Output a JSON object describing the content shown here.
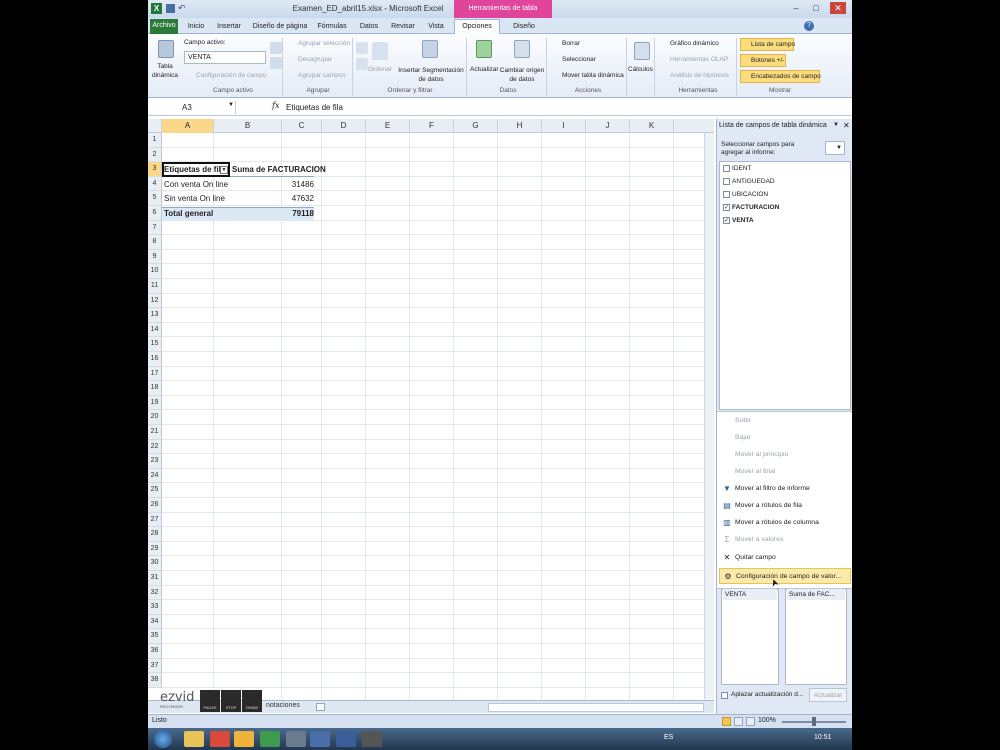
{
  "window": {
    "title": "Examen_ED_abril15.xlsx - Microsoft Excel",
    "context_tab_title": "Herramientas de tabla dinámica"
  },
  "tabs": [
    "Archivo",
    "Inicio",
    "Insertar",
    "Diseño de página",
    "Fórmulas",
    "Datos",
    "Revisar",
    "Vista",
    "Opciones",
    "Diseño"
  ],
  "ribbon": {
    "tabla_dinamica": "Tabla dinámica",
    "campo_activo_label": "Campo activo:",
    "campo_activo_value": "VENTA",
    "configuracion_campo": "Configuración de campo",
    "group_campo_activo": "Campo activo",
    "agrupar_seleccion": "Agrupar selección",
    "desagrupar": "Desagrupar",
    "agrupar_campos": "Agrupar campos",
    "group_agrupar": "Agrupar",
    "ordenar": "Ordenar",
    "insertar_segmentacion": "Insertar Segmentación de datos",
    "group_ordenar": "Ordenar y filtrar",
    "actualizar": "Actualizar",
    "cambiar_origen": "Cambiar origen de datos",
    "group_datos": "Datos",
    "borrar": "Borrar",
    "seleccionar": "Seleccionar",
    "mover_tabla": "Mover tabla dinámica",
    "group_acciones": "Acciones",
    "calculos": "Cálculos",
    "grafico_dinamico": "Gráfico dinámico",
    "herramientas_olap": "Herramientas OLAP",
    "analisis_hipotesis": "Análisis de hipótesis",
    "group_herramientas": "Herramientas",
    "lista_campo": "Lista de campo",
    "botones": "Botones +/-",
    "encabezados": "Encabezados de campo",
    "group_mostrar": "Mostrar"
  },
  "formula_bar": {
    "name_box": "A3",
    "fx": "fx",
    "content": "Etiquetas de fila"
  },
  "columns": [
    "A",
    "B",
    "C",
    "D",
    "E",
    "F",
    "G",
    "H",
    "I",
    "J",
    "K"
  ],
  "rows": [
    "1",
    "2",
    "3",
    "4",
    "5",
    "6",
    "7",
    "8",
    "9",
    "10",
    "11",
    "12",
    "13",
    "14",
    "15",
    "16",
    "17",
    "18",
    "19",
    "20",
    "21",
    "22",
    "23",
    "24",
    "25",
    "26",
    "27",
    "28",
    "29",
    "30",
    "31",
    "32",
    "33",
    "34",
    "35",
    "36",
    "37",
    "38"
  ],
  "pivot": {
    "header_label": "Etiquetas de fila",
    "header_value": "Suma de FACTURACION",
    "rows": [
      {
        "label": "Con venta On line",
        "value": "31486"
      },
      {
        "label": "Sin venta On line",
        "value": "47632"
      }
    ],
    "total_label": "Total general",
    "total_value": "79118"
  },
  "sheet_tab": "notaciones",
  "status": "Listo",
  "zoom": "100%",
  "pane": {
    "title": "Lista de campos de tabla dinámica",
    "subtitle": "Seleccionar campos para agregar al informe:",
    "fields": [
      {
        "name": "IDENT",
        "checked": false
      },
      {
        "name": "ANTIGUEDAD",
        "checked": false
      },
      {
        "name": "UBICACION",
        "checked": false
      },
      {
        "name": "FACTURACION",
        "checked": true
      },
      {
        "name": "VENTA",
        "checked": true
      }
    ],
    "menu": [
      {
        "label": "Subir",
        "enabled": false,
        "icon": ""
      },
      {
        "label": "Bajar",
        "enabled": false,
        "icon": ""
      },
      {
        "label": "Mover al principio",
        "enabled": false,
        "icon": ""
      },
      {
        "label": "Mover al final",
        "enabled": false,
        "icon": ""
      },
      {
        "label": "Mover al filtro de informe",
        "enabled": true,
        "icon": "filter-icon"
      },
      {
        "label": "Mover a rótulos de fila",
        "enabled": true,
        "icon": "rows-icon"
      },
      {
        "label": "Mover a rótulos de columna",
        "enabled": true,
        "icon": "columns-icon"
      },
      {
        "label": "Mover a valores",
        "enabled": false,
        "icon": "sigma-icon"
      },
      {
        "label": "Quitar campo",
        "enabled": true,
        "icon": "close-icon"
      },
      {
        "label": "Configuración de campo de valor...",
        "enabled": true,
        "icon": "settings-icon"
      }
    ],
    "area_left": "VENTA",
    "area_right": "Suma de FAC...",
    "defer_label": "Aplazar actualización d...",
    "update_button": "Actualizar"
  },
  "ezvid": {
    "logo": "ezvid",
    "sub": "RECORDER",
    "pause": "PAUSE",
    "stop": "STOP",
    "draw": "DRAW"
  },
  "taskbar": {
    "lang": "ES",
    "time": "10:51"
  }
}
